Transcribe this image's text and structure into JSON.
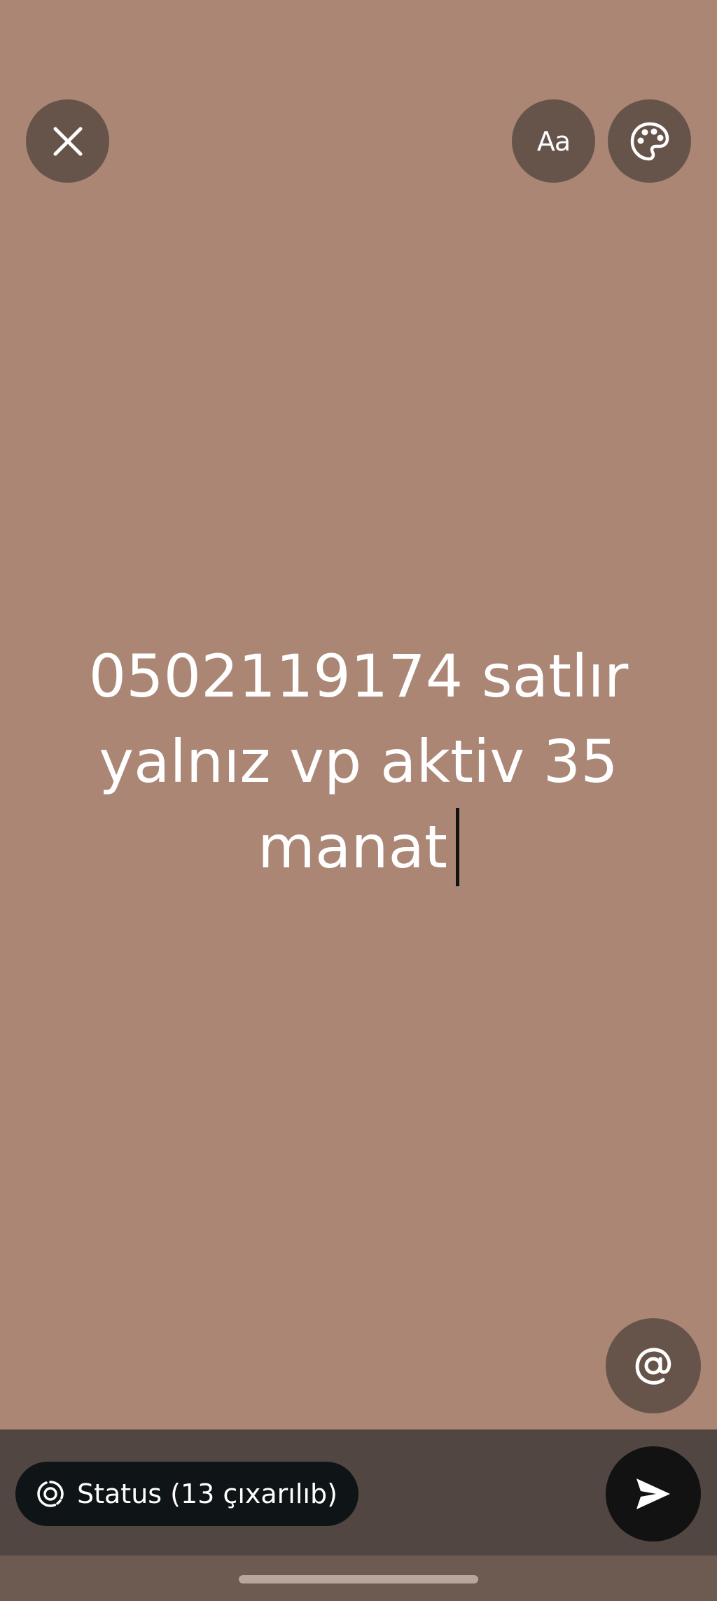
{
  "colors": {
    "background": "#ab8674",
    "button_bg": "#66544b",
    "bottom_bar": "#514642",
    "status_pill": "#0f1417",
    "send_button": "#121212",
    "text": "#ffffff"
  },
  "top_bar": {
    "close_icon": "close-icon",
    "font_button_label": "Aa",
    "palette_icon": "palette-icon"
  },
  "editor": {
    "lines": [
      "0502119174 satlır",
      "yalnız vp aktiv 35",
      "manat"
    ]
  },
  "mention_icon": "at-sign-icon",
  "status_pill": {
    "icon": "status-ring-icon",
    "label": "Status (13 çıxarılıb)"
  },
  "send_icon": "send-icon"
}
